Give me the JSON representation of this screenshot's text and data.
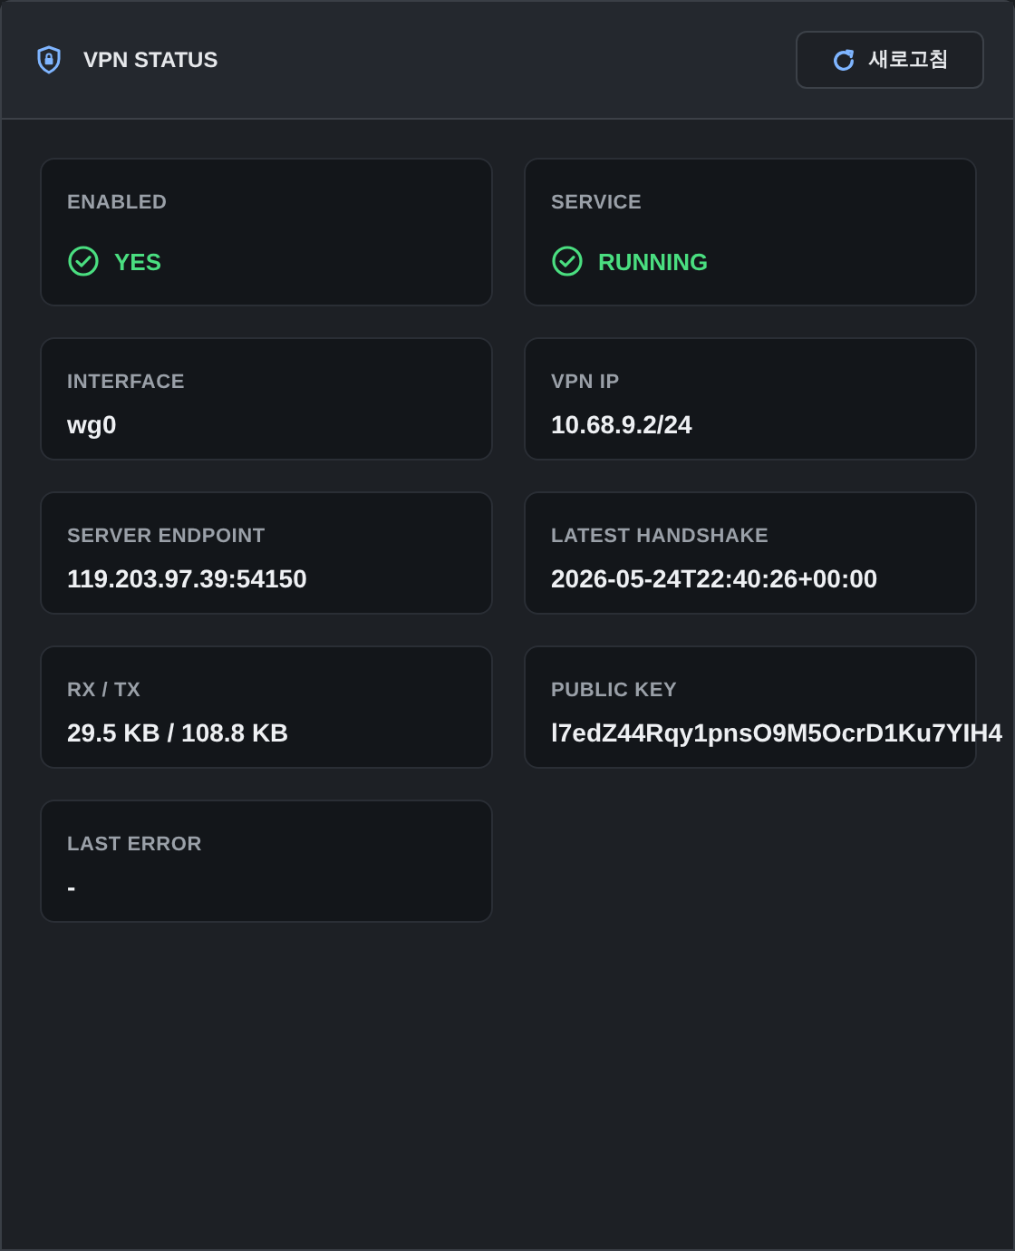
{
  "header": {
    "title": "VPN STATUS",
    "refresh_button": "새로고침"
  },
  "fields": [
    {
      "kind": "status",
      "label": "ENABLED",
      "value": "YES",
      "ok": true
    },
    {
      "kind": "status",
      "label": "SERVICE",
      "value": "RUNNING",
      "ok": true
    },
    {
      "kind": "text",
      "label": "INTERFACE",
      "value": "wg0"
    },
    {
      "kind": "text",
      "label": "VPN IP",
      "value": "10.68.9.2/24"
    },
    {
      "kind": "text",
      "label": "SERVER ENDPOINT",
      "value": "119.203.97.39:54150"
    },
    {
      "kind": "text",
      "label": "LATEST HANDSHAKE",
      "value": "2026-05-24T22:40:26+00:00"
    },
    {
      "kind": "text",
      "label": "RX / TX",
      "value": "29.5 KB / 108.8 KB"
    },
    {
      "kind": "text",
      "label": "PUBLIC KEY",
      "value": "l7edZ44Rqy1pnsO9M5OcrD1Ku7YIH4"
    },
    {
      "kind": "text",
      "label": "LAST ERROR",
      "value": "-"
    }
  ]
}
